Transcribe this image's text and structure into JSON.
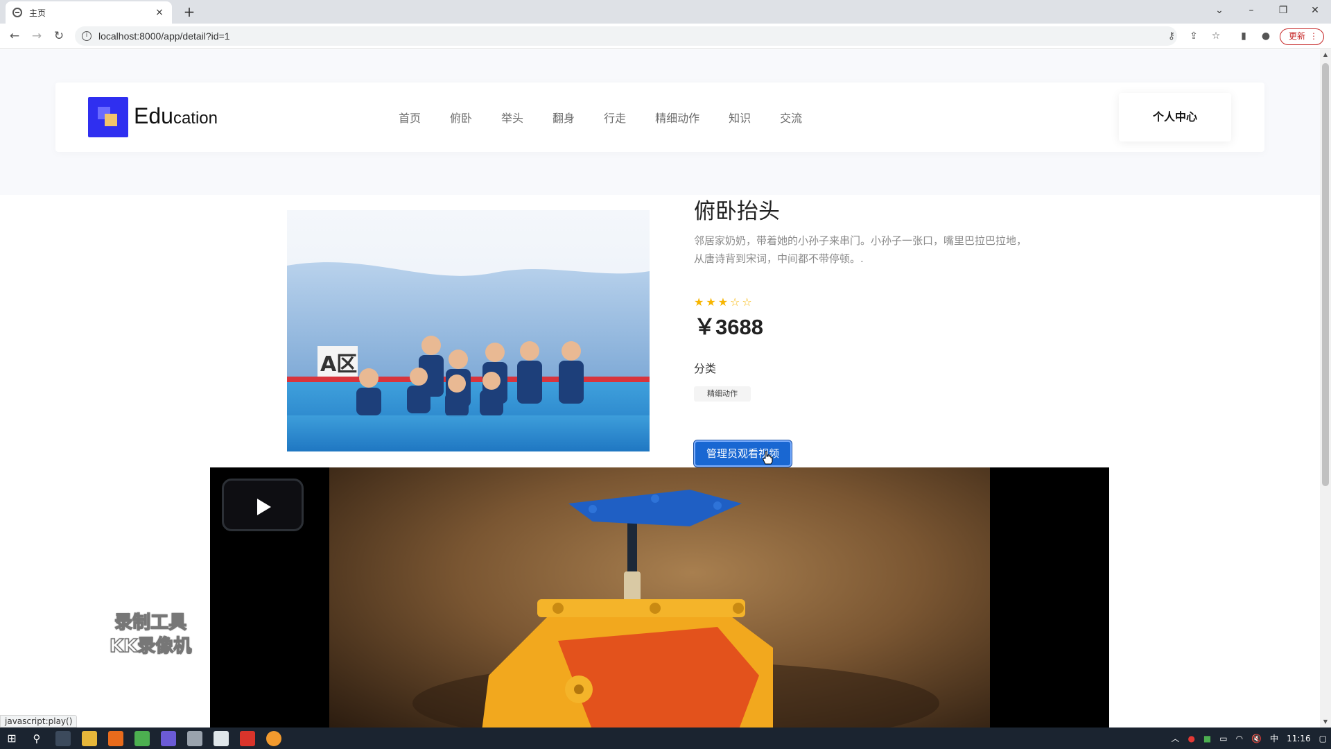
{
  "browser": {
    "tab_title": "主页",
    "tab_close": "×",
    "new_tab": "+",
    "url": "localhost:8000/app/detail?id=1",
    "update_label": "更新",
    "status_link": "javascript:play()"
  },
  "nav": {
    "logo_big": "Edu",
    "logo_small": "cation",
    "menu": [
      "首页",
      "俯卧",
      "举头",
      "翻身",
      "行走",
      "精细动作",
      "知识",
      "交流"
    ],
    "user_center": "个人中心"
  },
  "product": {
    "title": "俯卧抬头",
    "description": "邻居家奶奶，带着她的小孙子来串门。小孙子一张口，嘴里巴拉巴拉地，从唐诗背到宋词，中间都不带停顿。.",
    "rating": 3,
    "rating_max": 5,
    "price": "￥3688",
    "category_label": "分类",
    "category_tag": "精细动作",
    "watch_button": "管理员观看视频"
  },
  "image_text": "A区",
  "watermark": [
    "录制工具",
    "KK录像机"
  ],
  "taskbar": {
    "clock": "11:16",
    "ime": "中"
  },
  "colors": {
    "accent": "#1967d2",
    "star": "#f7b500",
    "logo": "#2f2ff0"
  }
}
